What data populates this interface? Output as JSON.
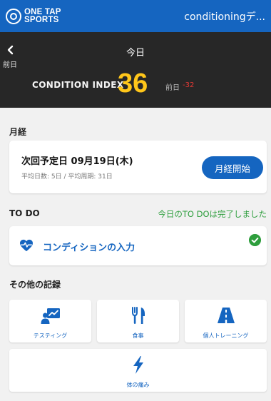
{
  "topbar": {
    "logo_line1": "ONE TAP",
    "logo_line2": "SPORTS",
    "app_name": "conditioningデ..."
  },
  "header": {
    "back_label": "前日",
    "date_title": "今日",
    "condition_index_label": "CONDITION INDEX",
    "condition_index_value": "36",
    "previous_label": "前日",
    "previous_diff": "-32"
  },
  "menstruation": {
    "section_title": "月経",
    "next_date": "次回予定日 09月19日(木)",
    "stats": "平均日数: 5日 / 平均周期: 31日",
    "start_button": "月経開始"
  },
  "todo": {
    "section_title": "TO DO",
    "status": "今日のTO DOは完了しました",
    "items": [
      {
        "label": "コンディションの入力",
        "icon": "heart-pulse-icon",
        "done": true
      }
    ]
  },
  "other_records": {
    "section_title": "その他の記録",
    "tiles": [
      {
        "label": "テスティング",
        "icon": "testing-icon"
      },
      {
        "label": "食事",
        "icon": "meal-icon"
      },
      {
        "label": "個人トレーニング",
        "icon": "road-icon"
      },
      {
        "label": "体の痛み",
        "icon": "lightning-icon"
      }
    ]
  },
  "colors": {
    "brand_blue": "#1565c0",
    "header_dark": "#272727",
    "index_yellow": "#ffc61a",
    "diff_red": "#e53935",
    "done_green": "#2e9e3d"
  }
}
